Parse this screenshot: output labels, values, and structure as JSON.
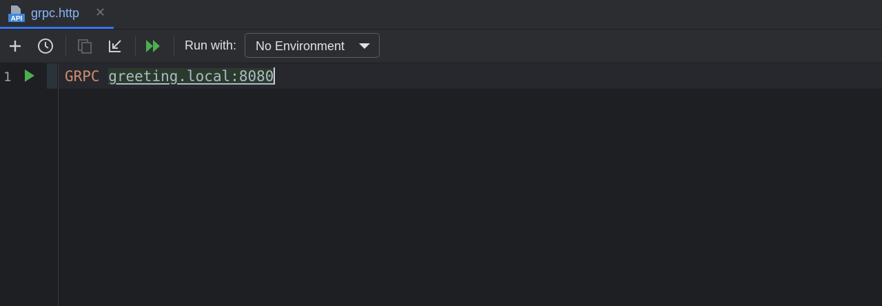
{
  "tab": {
    "filename": "grpc.http",
    "icon": "api-file-icon",
    "icon_text": "API",
    "close": "✕"
  },
  "toolbar": {
    "add_icon": "plus-icon",
    "history_icon": "clock-icon",
    "copy_icon": "copy-icon",
    "import_icon": "import-arrow-icon",
    "run_all_icon": "run-all-icon",
    "run_with_label": "Run with:",
    "environment": "No Environment"
  },
  "editor": {
    "line_number": "1",
    "method": "GRPC",
    "address": "greeting.local:8080"
  },
  "colors": {
    "accent": "#3574f0",
    "run_green": "#4caf50",
    "keyword": "#cf8e6d"
  }
}
